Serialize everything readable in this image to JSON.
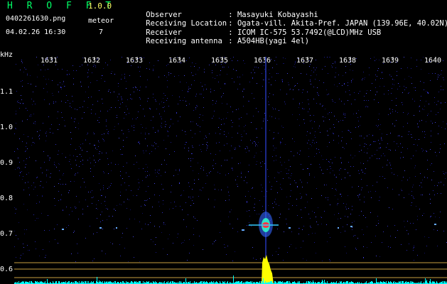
{
  "header": {
    "app_title": "H R O F F T",
    "app_version": "1.0.0",
    "file_name": "0402261630.png",
    "meteor_label": "meteor",
    "date_time": "04.02.26 16:30",
    "meteor_count": "7"
  },
  "info": {
    "observer_label": "Observer",
    "observer_value": ": Masayuki Kobayashi",
    "location_label": "Receiving Location",
    "location_value": ": Ogata-vill. Akita-Pref. JAPAN (139.96E, 40.02N)",
    "receiver_label": "Receiver",
    "receiver_value": ": ICOM IC-575 53.7492(@LCD)MHz USB",
    "antenna_label": "Receiving antenna",
    "antenna_value": ": A504HB(yagi 4el)"
  },
  "axis": {
    "unit": "kHz",
    "x_ticks": [
      "1631",
      "1632",
      "1633",
      "1634",
      "1635",
      "1636",
      "1637",
      "1638",
      "1639",
      "1640"
    ],
    "y_ticks": [
      "1.1",
      "1.0",
      "0.9",
      "0.8",
      "0.7",
      "0.6"
    ]
  },
  "colors": {
    "noise": "#1a1a8c",
    "signal_core": "#ff3344",
    "signal_mid": "#33ffcc",
    "signal_edge": "#3366ff",
    "audio_level": "#ffff00",
    "baseline": "#00ffff",
    "ref_line": "#c8a040"
  }
}
